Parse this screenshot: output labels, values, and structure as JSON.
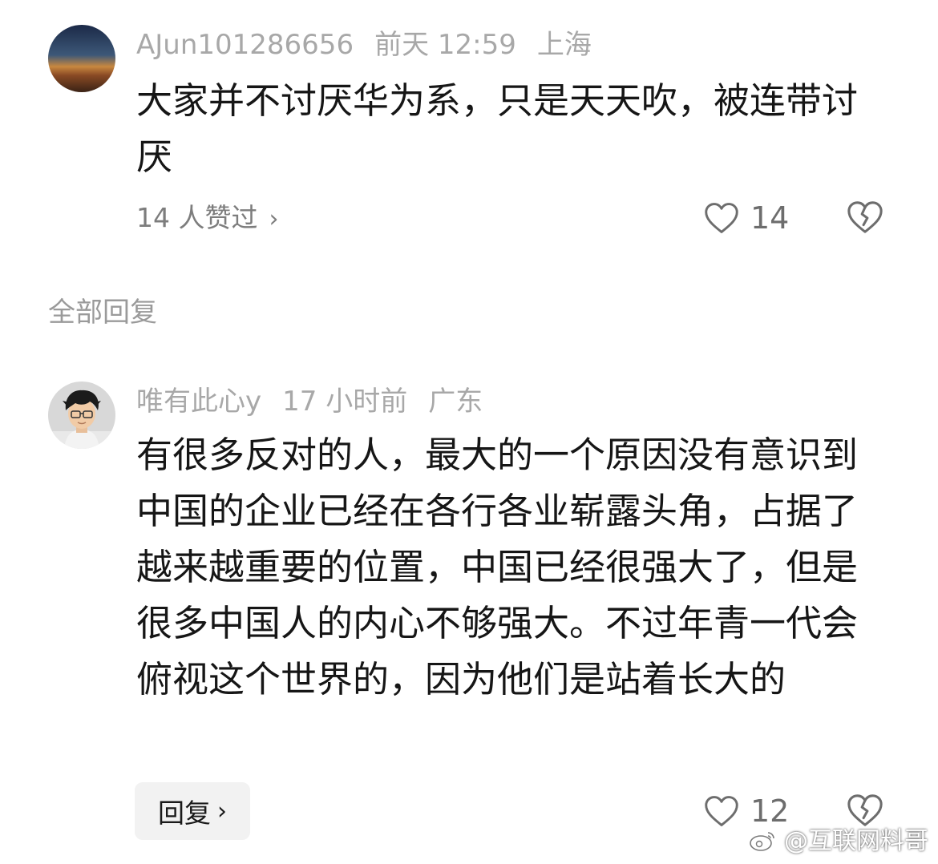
{
  "comment1": {
    "username": "AJun101286656",
    "time": "前天 12:59",
    "location": "上海",
    "text": "大家并不讨厌华为系，只是天天吹，被连带讨厌",
    "likers": "14 人赞过",
    "likers_chevron": "›",
    "like_count": "14",
    "avatar_colors": [
      "#1f2d4d",
      "#a86a3a",
      "#5a3520"
    ]
  },
  "section_title": "全部回复",
  "comment2": {
    "username": "唯有此心y",
    "time": "17 小时前",
    "location": "广东",
    "text": "有很多反对的人，最大的一个原因没有意识到中国的企业已经在各行各业崭露头角，占据了越来越重要的位置，中国已经很强大了，但是很多中国人的内心不够强大。不过年青一代会俯视这个世界的，因为他们是站着长大的",
    "reply_label": "回复",
    "reply_chevron": "›",
    "like_count": "12"
  },
  "watermark": "@互联网料哥",
  "icons": {
    "like": "heart-outline-icon",
    "dislike": "broken-heart-icon",
    "chevron": "chevron-right-icon",
    "watermark": "weibo-logo-icon"
  },
  "colors": {
    "meta": "#a8a8a8",
    "body_text": "#161616",
    "icon": "#6d6d6d",
    "reply_bg": "#f2f2f2"
  }
}
